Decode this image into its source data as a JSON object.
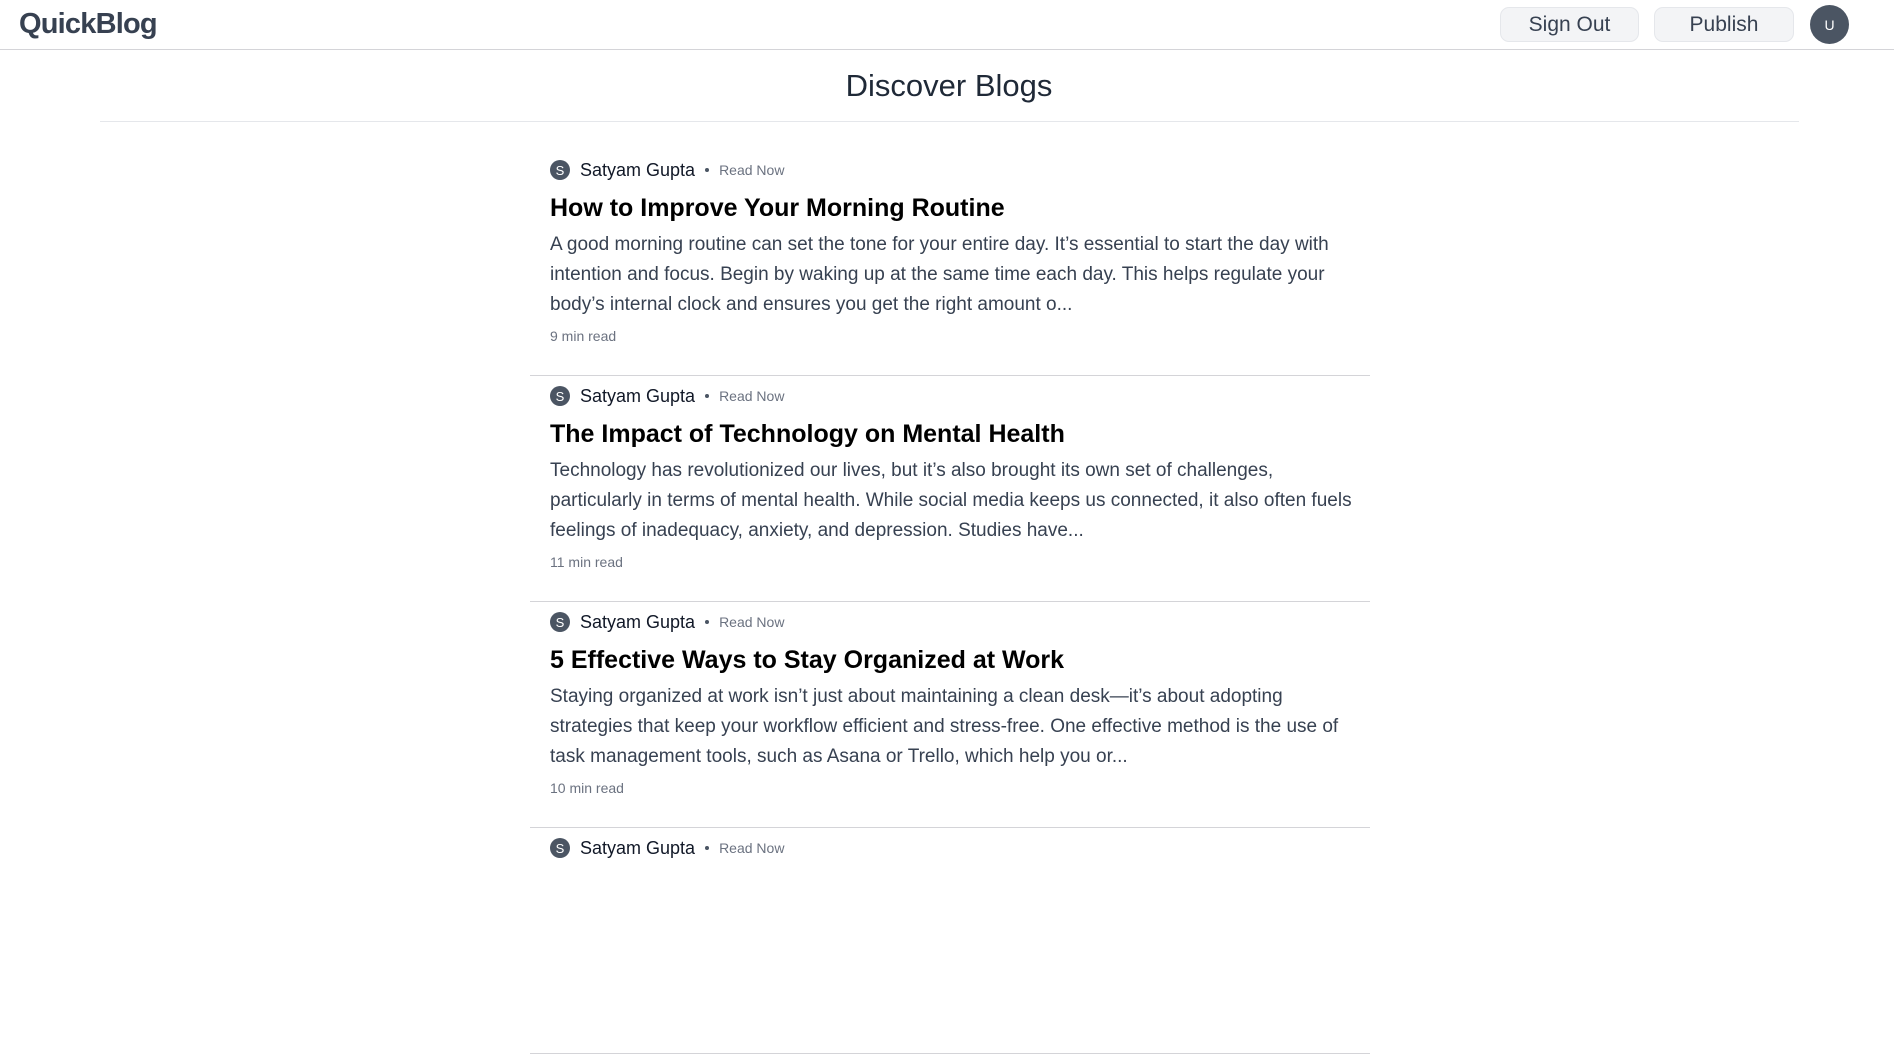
{
  "header": {
    "logo": "QuickBlog",
    "sign_out_label": "Sign Out",
    "publish_label": "Publish",
    "user_initial": "U"
  },
  "page": {
    "title": "Discover Blogs"
  },
  "posts": [
    {
      "author_initial": "S",
      "author": "Satyam Gupta",
      "read_now": "Read Now",
      "title": "How to Improve Your Morning Routine",
      "excerpt": "A good morning routine can set the tone for your entire day. It’s essential to start the day with intention and focus. Begin by waking up at the same time each day. This helps regulate your body’s internal clock and ensures you get the right amount o...",
      "read_time": "9 min read"
    },
    {
      "author_initial": "S",
      "author": "Satyam Gupta",
      "read_now": "Read Now",
      "title": "The Impact of Technology on Mental Health",
      "excerpt": "Technology has revolutionized our lives, but it’s also brought its own set of challenges, particularly in terms of mental health. While social media keeps us connected, it also often fuels feelings of inadequacy, anxiety, and depression. Studies have...",
      "read_time": "11 min read"
    },
    {
      "author_initial": "S",
      "author": "Satyam Gupta",
      "read_now": "Read Now",
      "title": "5 Effective Ways to Stay Organized at Work",
      "excerpt": "Staying organized at work isn’t just about maintaining a clean desk—it’s about adopting strategies that keep your workflow efficient and stress-free. One effective method is the use of task management tools, such as Asana or Trello, which help you or...",
      "read_time": "10 min read"
    },
    {
      "author_initial": "S",
      "author": "Satyam Gupta",
      "read_now": "Read Now"
    }
  ]
}
